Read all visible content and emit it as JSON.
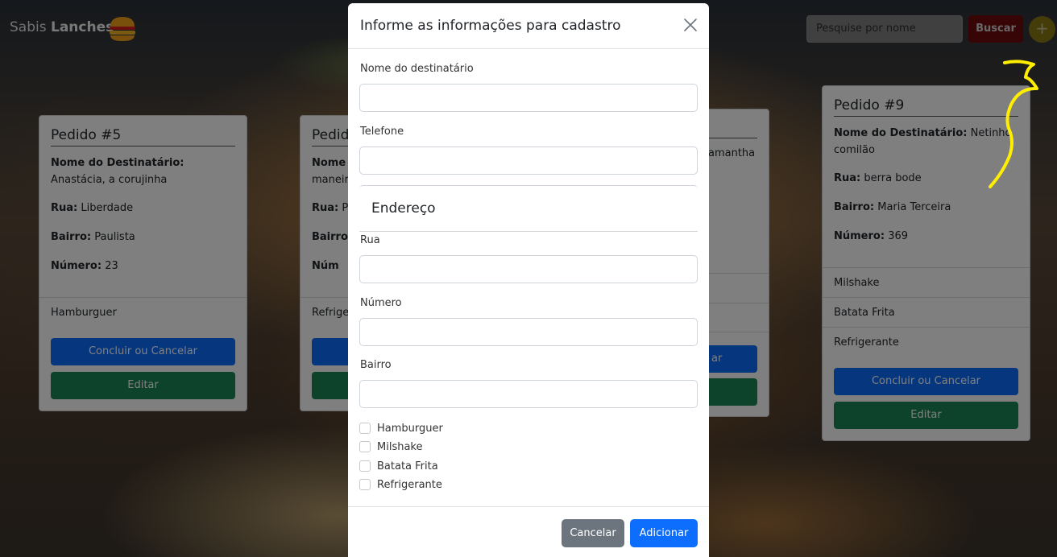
{
  "navbar": {
    "brand_prefix": "Sabis",
    "brand_bold": "Lanches",
    "search_placeholder": "Pesquise por nome",
    "search_button": "Buscar",
    "add_button": "+"
  },
  "cards": [
    {
      "title": "Pedido #5",
      "recipient_label": "Nome do Destinatário:",
      "recipient": "Anastácia, a corujinha",
      "street_label": "Rua:",
      "street": "Liberdade",
      "district_label": "Bairro:",
      "district": "Paulista",
      "number_label": "Número:",
      "number": "23",
      "items": [
        "Hamburguer"
      ],
      "conclude_button": "Concluir ou Cancelar",
      "edit_button": "Editar"
    },
    {
      "title": "Pedid",
      "recipient_label": "Nome",
      "recipient_line2": "maneir",
      "street_label": "Rua:",
      "street": "Po",
      "district_label": "Bairro:",
      "number_label": "Núm",
      "items": [
        "Refrige"
      ]
    },
    {
      "recipient_fragment": "amantha",
      "button_fragment": "ar"
    },
    {
      "title": "Pedido #9",
      "recipient_label": "Nome do Destinatário:",
      "recipient": "Netinho comilão",
      "street_label": "Rua:",
      "street": "berra bode",
      "district_label": "Bairro:",
      "district": "Maria Terceira",
      "number_label": "Número:",
      "number": "369",
      "items": [
        "Milshake",
        "Batata Frita",
        "Refrigerante"
      ],
      "conclude_button": "Concluir ou Cancelar",
      "edit_button": "Editar"
    }
  ],
  "modal": {
    "title": "Informe as informações para cadastro",
    "recipient_label": "Nome do destinatário",
    "recipient_value": "",
    "phone_label": "Telefone",
    "phone_value": "",
    "address_title": "Endereço",
    "street_label": "Rua",
    "street_value": "",
    "number_label": "Número",
    "number_value": "",
    "district_label": "Bairro",
    "district_value": "",
    "products": [
      {
        "label": "Hamburguer",
        "checked": false
      },
      {
        "label": "Milshake",
        "checked": false
      },
      {
        "label": "Batata Frita",
        "checked": false
      },
      {
        "label": "Refrigerante",
        "checked": false
      }
    ],
    "cancel_button": "Cancelar",
    "add_button": "Adicionar"
  },
  "colors": {
    "primary": "#0d6efd",
    "success": "#198754",
    "danger": "#dc3545",
    "secondary": "#6c757d",
    "warning": "#ffc107",
    "annotation": "#ffee00"
  }
}
